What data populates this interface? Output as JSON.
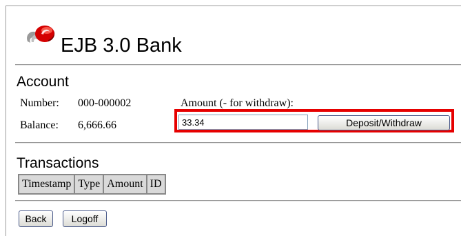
{
  "app": {
    "title": "EJB 3.0 Bank"
  },
  "account": {
    "heading": "Account",
    "number_label": "Number:",
    "number_value": "000-000002",
    "balance_label": "Balance:",
    "balance_value": "6,666.66",
    "amount_label": "Amount (- for withdraw):",
    "amount_value": "33.34",
    "deposit_button": "Deposit/Withdraw"
  },
  "transactions": {
    "heading": "Transactions",
    "columns": [
      "Timestamp",
      "Type",
      "Amount",
      "ID"
    ]
  },
  "actions": {
    "back": "Back",
    "logoff": "Logoff"
  },
  "colors": {
    "highlight": "#e60000",
    "logo_red": "#d40000",
    "logo_gray": "#9a9a9a"
  },
  "icons": {
    "logo": "ejb-bank-logo-icon"
  }
}
